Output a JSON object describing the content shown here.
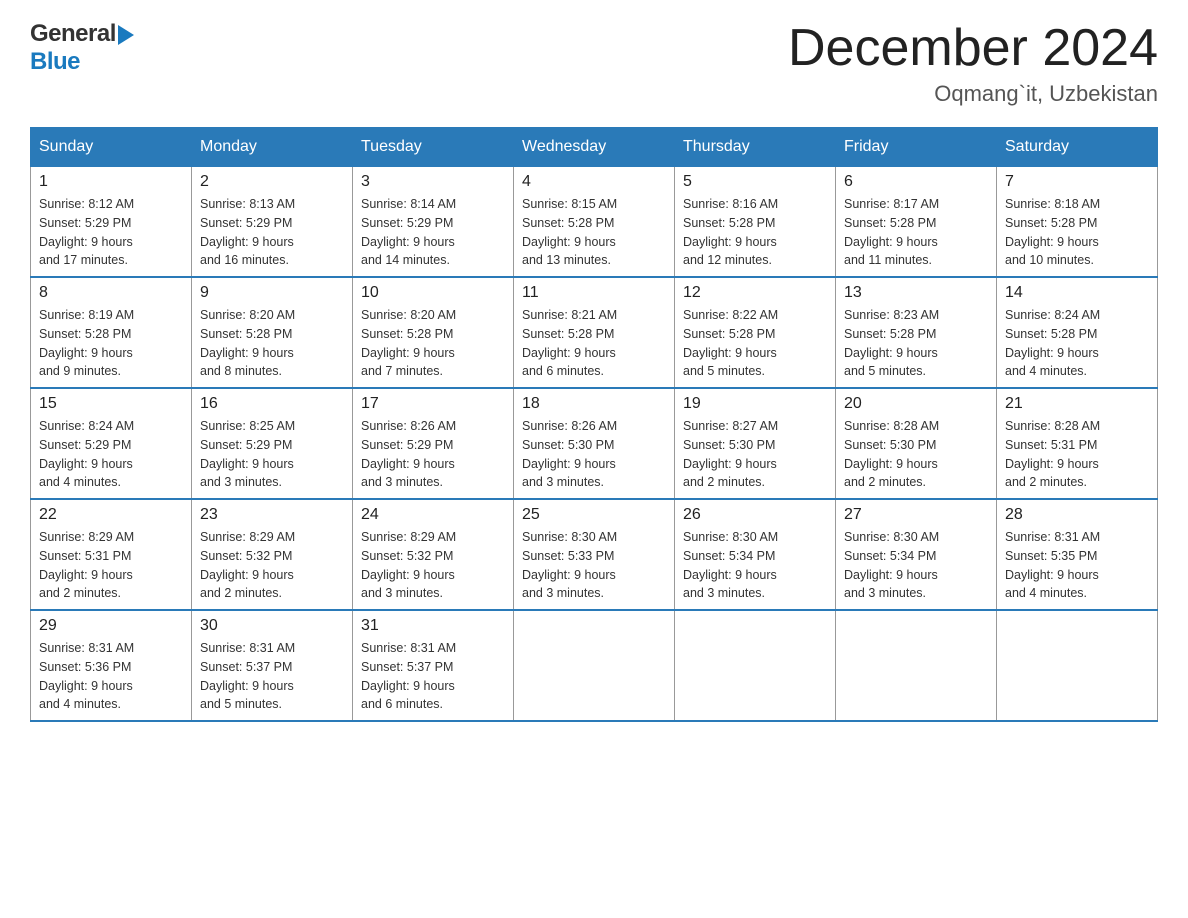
{
  "header": {
    "logo_general": "General",
    "logo_blue": "Blue",
    "month_title": "December 2024",
    "location": "Oqmang`it, Uzbekistan"
  },
  "days_of_week": [
    "Sunday",
    "Monday",
    "Tuesday",
    "Wednesday",
    "Thursday",
    "Friday",
    "Saturday"
  ],
  "weeks": [
    [
      {
        "day": "1",
        "sunrise": "8:12 AM",
        "sunset": "5:29 PM",
        "daylight": "9 hours and 17 minutes."
      },
      {
        "day": "2",
        "sunrise": "8:13 AM",
        "sunset": "5:29 PM",
        "daylight": "9 hours and 16 minutes."
      },
      {
        "day": "3",
        "sunrise": "8:14 AM",
        "sunset": "5:29 PM",
        "daylight": "9 hours and 14 minutes."
      },
      {
        "day": "4",
        "sunrise": "8:15 AM",
        "sunset": "5:28 PM",
        "daylight": "9 hours and 13 minutes."
      },
      {
        "day": "5",
        "sunrise": "8:16 AM",
        "sunset": "5:28 PM",
        "daylight": "9 hours and 12 minutes."
      },
      {
        "day": "6",
        "sunrise": "8:17 AM",
        "sunset": "5:28 PM",
        "daylight": "9 hours and 11 minutes."
      },
      {
        "day": "7",
        "sunrise": "8:18 AM",
        "sunset": "5:28 PM",
        "daylight": "9 hours and 10 minutes."
      }
    ],
    [
      {
        "day": "8",
        "sunrise": "8:19 AM",
        "sunset": "5:28 PM",
        "daylight": "9 hours and 9 minutes."
      },
      {
        "day": "9",
        "sunrise": "8:20 AM",
        "sunset": "5:28 PM",
        "daylight": "9 hours and 8 minutes."
      },
      {
        "day": "10",
        "sunrise": "8:20 AM",
        "sunset": "5:28 PM",
        "daylight": "9 hours and 7 minutes."
      },
      {
        "day": "11",
        "sunrise": "8:21 AM",
        "sunset": "5:28 PM",
        "daylight": "9 hours and 6 minutes."
      },
      {
        "day": "12",
        "sunrise": "8:22 AM",
        "sunset": "5:28 PM",
        "daylight": "9 hours and 5 minutes."
      },
      {
        "day": "13",
        "sunrise": "8:23 AM",
        "sunset": "5:28 PM",
        "daylight": "9 hours and 5 minutes."
      },
      {
        "day": "14",
        "sunrise": "8:24 AM",
        "sunset": "5:28 PM",
        "daylight": "9 hours and 4 minutes."
      }
    ],
    [
      {
        "day": "15",
        "sunrise": "8:24 AM",
        "sunset": "5:29 PM",
        "daylight": "9 hours and 4 minutes."
      },
      {
        "day": "16",
        "sunrise": "8:25 AM",
        "sunset": "5:29 PM",
        "daylight": "9 hours and 3 minutes."
      },
      {
        "day": "17",
        "sunrise": "8:26 AM",
        "sunset": "5:29 PM",
        "daylight": "9 hours and 3 minutes."
      },
      {
        "day": "18",
        "sunrise": "8:26 AM",
        "sunset": "5:30 PM",
        "daylight": "9 hours and 3 minutes."
      },
      {
        "day": "19",
        "sunrise": "8:27 AM",
        "sunset": "5:30 PM",
        "daylight": "9 hours and 2 minutes."
      },
      {
        "day": "20",
        "sunrise": "8:28 AM",
        "sunset": "5:30 PM",
        "daylight": "9 hours and 2 minutes."
      },
      {
        "day": "21",
        "sunrise": "8:28 AM",
        "sunset": "5:31 PM",
        "daylight": "9 hours and 2 minutes."
      }
    ],
    [
      {
        "day": "22",
        "sunrise": "8:29 AM",
        "sunset": "5:31 PM",
        "daylight": "9 hours and 2 minutes."
      },
      {
        "day": "23",
        "sunrise": "8:29 AM",
        "sunset": "5:32 PM",
        "daylight": "9 hours and 2 minutes."
      },
      {
        "day": "24",
        "sunrise": "8:29 AM",
        "sunset": "5:32 PM",
        "daylight": "9 hours and 3 minutes."
      },
      {
        "day": "25",
        "sunrise": "8:30 AM",
        "sunset": "5:33 PM",
        "daylight": "9 hours and 3 minutes."
      },
      {
        "day": "26",
        "sunrise": "8:30 AM",
        "sunset": "5:34 PM",
        "daylight": "9 hours and 3 minutes."
      },
      {
        "day": "27",
        "sunrise": "8:30 AM",
        "sunset": "5:34 PM",
        "daylight": "9 hours and 3 minutes."
      },
      {
        "day": "28",
        "sunrise": "8:31 AM",
        "sunset": "5:35 PM",
        "daylight": "9 hours and 4 minutes."
      }
    ],
    [
      {
        "day": "29",
        "sunrise": "8:31 AM",
        "sunset": "5:36 PM",
        "daylight": "9 hours and 4 minutes."
      },
      {
        "day": "30",
        "sunrise": "8:31 AM",
        "sunset": "5:37 PM",
        "daylight": "9 hours and 5 minutes."
      },
      {
        "day": "31",
        "sunrise": "8:31 AM",
        "sunset": "5:37 PM",
        "daylight": "9 hours and 6 minutes."
      },
      null,
      null,
      null,
      null
    ]
  ],
  "labels": {
    "sunrise": "Sunrise:",
    "sunset": "Sunset:",
    "daylight": "Daylight:"
  }
}
